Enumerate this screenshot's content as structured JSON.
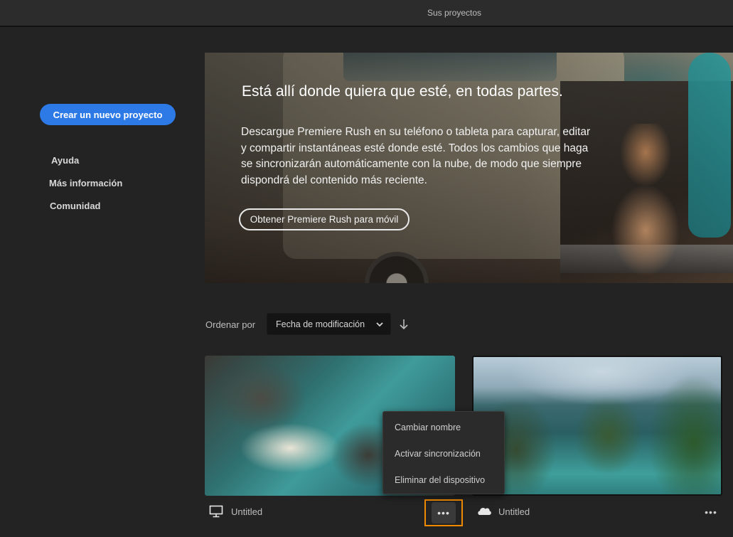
{
  "window": {
    "title": "Sus proyectos"
  },
  "sidebar": {
    "create_button": "Crear un nuevo proyecto",
    "links": [
      "Ayuda",
      "Más información",
      "Comunidad"
    ]
  },
  "hero": {
    "title": "Está allí donde quiera que esté, en todas partes.",
    "body": "Descargue Premiere Rush en su teléfono o tableta para capturar, editar y compartir instantáneas esté donde esté. Todos los cambios que haga se sincronizarán automáticamente con la nube, de modo que siempre dispondrá del contenido más reciente.",
    "button": "Obtener Premiere Rush para móvil"
  },
  "sort": {
    "label": "Ordenar por",
    "selected": "Fecha de modificación",
    "direction": "descending"
  },
  "projects": [
    {
      "name": "Untitled",
      "location_icon": "monitor-icon"
    },
    {
      "name": "Untitled",
      "location_icon": "cloud-icon"
    }
  ],
  "context_menu": {
    "items": [
      "Cambiar nombre",
      "Activar sincronización",
      "Eliminar del dispositivo"
    ]
  },
  "more_label": "•••",
  "colors": {
    "accent": "#2d7ae6",
    "highlight": "#f08a00",
    "background": "#232323"
  }
}
